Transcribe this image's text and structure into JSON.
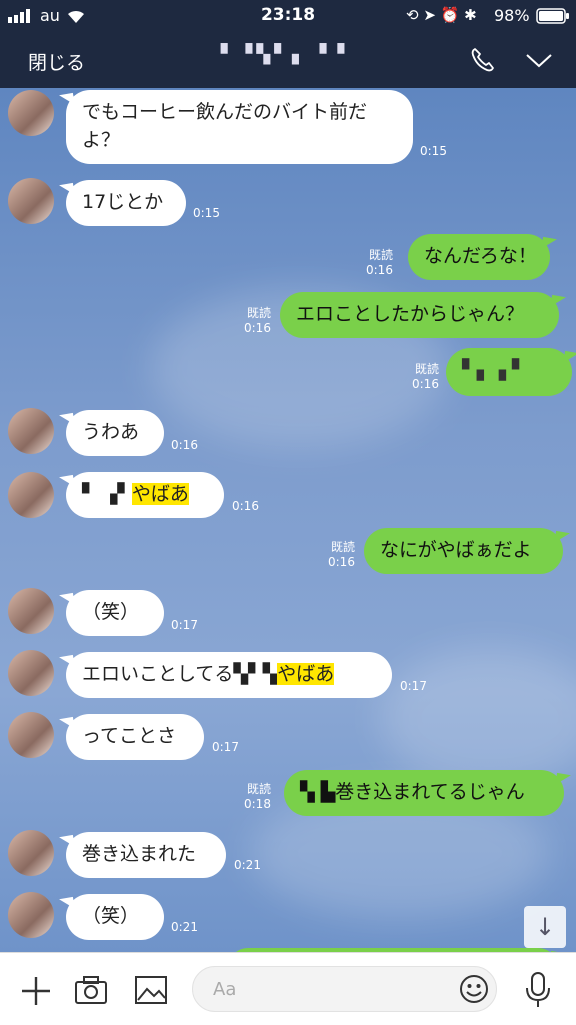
{
  "status_bar": {
    "carrier": "au",
    "time": "23:18",
    "battery": "98%"
  },
  "header": {
    "close_label": "閉じる",
    "title": "▘▝▚▘▖ ▘▘"
  },
  "messages": [
    {
      "dir": "in",
      "text": "でもコーヒー飲んだのバイト前だ\nよ？",
      "time": "0:15"
    },
    {
      "dir": "in",
      "text": "17じとか",
      "time": "0:15"
    },
    {
      "dir": "out",
      "text": "なんだろな！",
      "read": "既読",
      "time": "0:16"
    },
    {
      "dir": "out",
      "text": "エロことしたからじゃん？",
      "read": "既読",
      "time": "0:16"
    },
    {
      "dir": "out",
      "text": "▘▖▗ ▘",
      "read": "既読",
      "time": "0:16"
    },
    {
      "dir": "in",
      "text": "うわあ",
      "time": "0:16"
    },
    {
      "dir": "in",
      "text_pre": "▘ ▗▘",
      "text_hl": "やばあ",
      "time": "0:16"
    },
    {
      "dir": "out",
      "text": "なにがやばぁだよ",
      "read": "既読",
      "time": "0:16"
    },
    {
      "dir": "in",
      "text": "（笑）",
      "time": "0:17"
    },
    {
      "dir": "in",
      "text_pre": "エロいことしてる▚▘▚",
      "text_hl": "やばあ",
      "time": "0:17"
    },
    {
      "dir": "in",
      "text": "ってことさ",
      "time": "0:17"
    },
    {
      "dir": "out",
      "text_pre": "▚ ▙",
      "text": "巻き込まれてるじゃん",
      "read": "既読",
      "time": "0:18"
    },
    {
      "dir": "in",
      "text": "巻き込まれた",
      "time": "0:21"
    },
    {
      "dir": "in",
      "text": "（笑）",
      "time": "0:21"
    }
  ],
  "input": {
    "placeholder": "Aa"
  },
  "icons": {
    "phone": "phone-icon",
    "chevron": "chevron-down-icon",
    "plus": "plus-icon",
    "camera": "camera-icon",
    "image": "image-icon",
    "emoji": "emoji-icon",
    "mic": "microphone-icon",
    "scroll": "arrow-down-icon"
  }
}
